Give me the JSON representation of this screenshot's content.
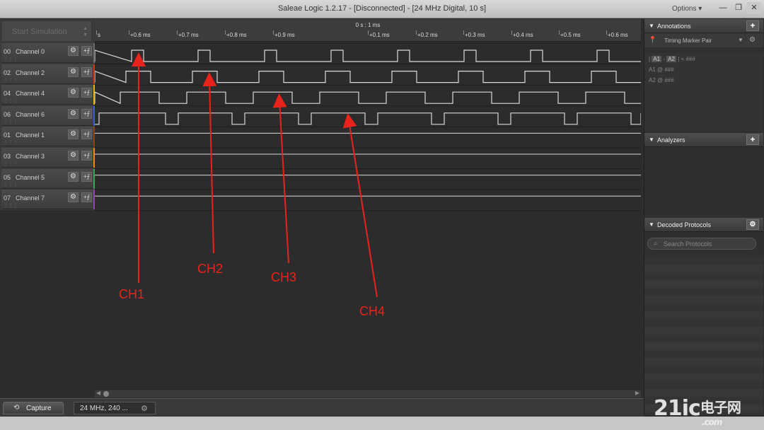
{
  "window": {
    "title": "Saleae Logic 1.2.17 - [Disconnected] - [24 MHz Digital, 10 s]",
    "options_label": "Options ▾"
  },
  "left_panel": {
    "start_simulation": "Start Simulation",
    "channels": [
      {
        "num": "00",
        "name": "Channel 0",
        "color": "#6a6a6a"
      },
      {
        "num": "02",
        "name": "Channel 2",
        "color": "#d4351c"
      },
      {
        "num": "04",
        "name": "Channel 4",
        "color": "#e6b800"
      },
      {
        "num": "06",
        "name": "Channel 6",
        "color": "#3b5bdb"
      },
      {
        "num": "01",
        "name": "Channel 1",
        "color": "#8b4513"
      },
      {
        "num": "03",
        "name": "Channel 3",
        "color": "#f08a00"
      },
      {
        "num": "05",
        "name": "Channel 5",
        "color": "#3aa655"
      },
      {
        "num": "07",
        "name": "Channel 7",
        "color": "#8e44ad"
      }
    ]
  },
  "ruler": {
    "center_label": "0 s : 1 ms",
    "ticks": [
      "s",
      "+0.6 ms",
      "+0.7 ms",
      "+0.8 ms",
      "+0.9 ms",
      "+0.1 ms",
      "+0.2 ms",
      "+0.3 ms",
      "+0.4 ms",
      "+0.5 ms",
      "+0.6 ms"
    ]
  },
  "bottom": {
    "capture_label": "Capture",
    "session_label": "24 MHz, 240 ..."
  },
  "right_panel": {
    "annotations": {
      "header": "Annotations",
      "marker_pair": "Timing Marker Pair",
      "line1_a1": "A1",
      "line1_a2": "A2",
      "line1_rest": "| = ###",
      "line2": "A1 @ ###",
      "line3": "A2 @ ###"
    },
    "analyzers": {
      "header": "Analyzers"
    },
    "decoded": {
      "header": "Decoded Protocols",
      "search_placeholder": "Search Protocols"
    }
  },
  "overlay_labels": {
    "ch1": "CH1",
    "ch2": "CH2",
    "ch3": "CH3",
    "ch4": "CH4"
  },
  "watermark": {
    "brand": "21ic",
    "cn": "电子网",
    "domain": ".com"
  },
  "colors": {
    "annotation_red": "#e8231b",
    "waveform": "#d9d9d9"
  }
}
